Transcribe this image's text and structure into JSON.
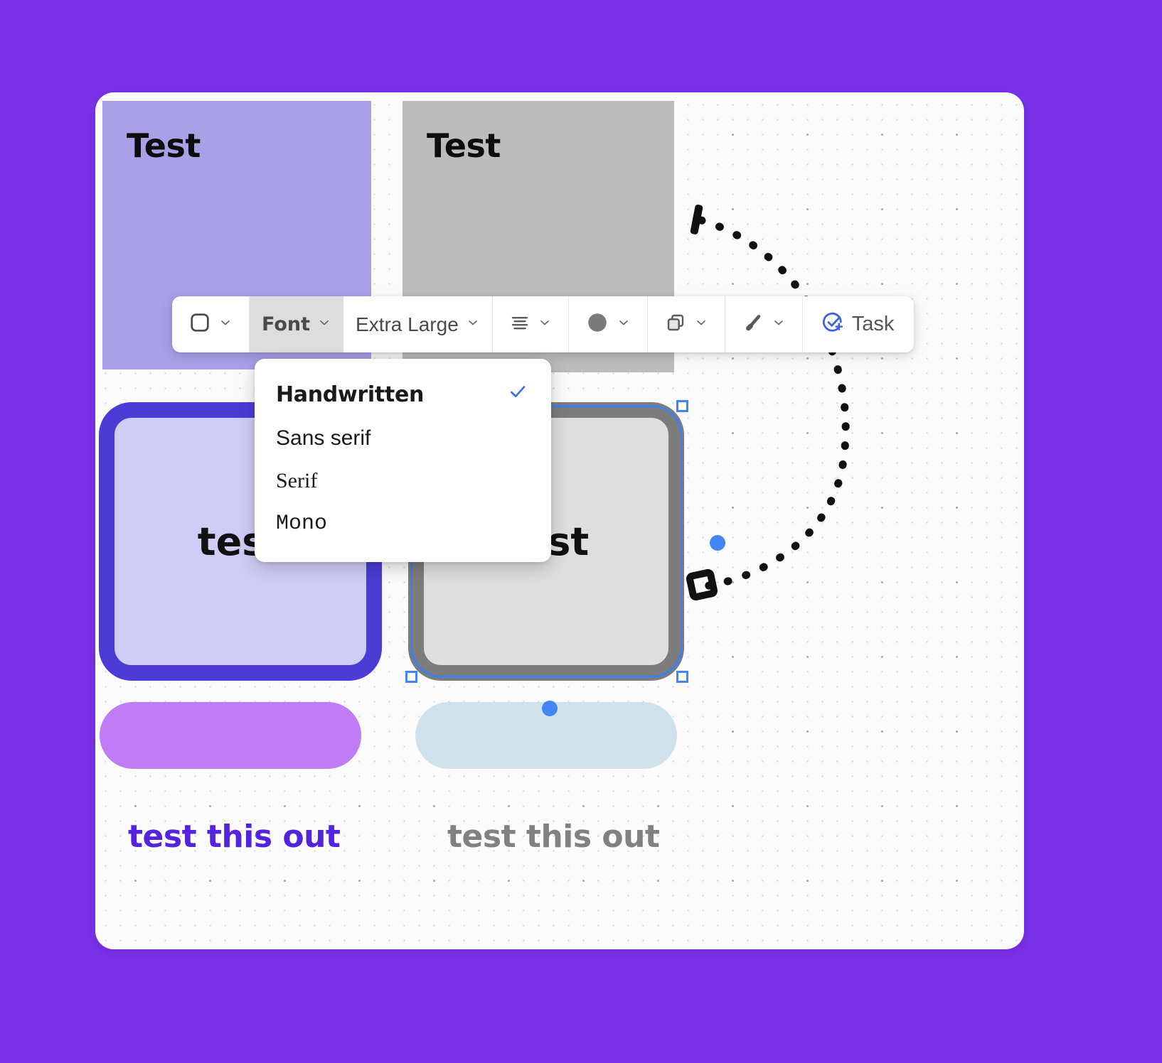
{
  "app": {
    "background_color": "#7C32EB",
    "canvas_color": "#FBFBFB"
  },
  "canvas": {
    "sticky_notes": [
      {
        "text": "Test",
        "color": "#A9A0E8",
        "name": "sticky-note-purple"
      },
      {
        "text": "Test",
        "color": "#BCBCBC",
        "name": "sticky-note-gray"
      }
    ],
    "shapes": [
      {
        "text": "test",
        "fill": "#CFCDF5",
        "stroke": "#4C3BD4",
        "selected": false
      },
      {
        "text": "test",
        "fill": "#DEDEDE",
        "stroke": "#7C7C7C",
        "selected": true
      }
    ],
    "highlighters": [
      {
        "color": "#C07CF5",
        "name": "highlighter-purple"
      },
      {
        "color": "#CFE2EC",
        "name": "highlighter-blue"
      }
    ],
    "text_labels": [
      {
        "text": "test this out",
        "color": "#5423E0"
      },
      {
        "text": "test this out",
        "color": "#818181"
      }
    ],
    "connector": {
      "style": "dotted",
      "color": "#111111"
    }
  },
  "toolbar": {
    "shape_icon": "rounded-square-icon",
    "font_label": "Font",
    "font_active": true,
    "size_label": "Extra Large",
    "align_icon": "text-align-icon",
    "color_icon": "color-swatch-icon",
    "color_value": "#7B7B7B",
    "layers_icon": "duplicate-layers-icon",
    "stroke_icon": "pen-stroke-icon",
    "task_label": "Task",
    "task_icon": "task-check-plus-icon",
    "task_color": "#3B62E0",
    "chevron_icon": "chevron-down-icon"
  },
  "font_menu": {
    "items": [
      {
        "label": "Handwritten",
        "style": "handwritten",
        "checked": true
      },
      {
        "label": "Sans serif",
        "style": "sans",
        "checked": false
      },
      {
        "label": "Serif",
        "style": "serif",
        "checked": false
      },
      {
        "label": "Mono",
        "style": "mono",
        "checked": false
      }
    ],
    "check_icon": "checkmark-icon"
  }
}
